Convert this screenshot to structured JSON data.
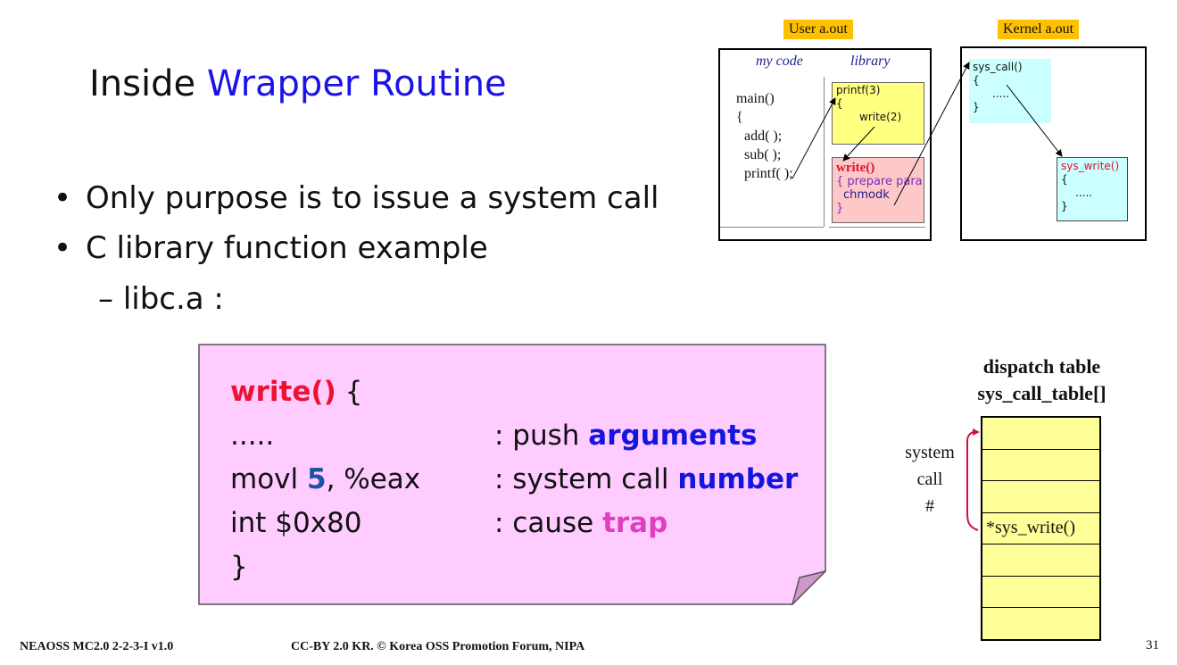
{
  "slide": {
    "title_plain": "Inside ",
    "title_accent": "Wrapper Routine",
    "bullets": [
      "Only purpose is to issue a system call",
      "C library function example"
    ],
    "sub_bullet": "libc.a :",
    "bullet_marker": "•",
    "sub_bullet_marker": "–",
    "page_number": "31"
  },
  "colors": {
    "title_accent": "#1a12e8",
    "tag_bg": "#ffc000",
    "note_bg": "#ffccff",
    "table_bg": "#ffff99"
  },
  "diagram": {
    "user_tag": "User   a.out",
    "kernel_tag": "Kernel   a.out",
    "my_code_label": "my code",
    "library_label": "library",
    "my_code_lines": [
      "main()",
      "{",
      "  add( );",
      "  sub( );",
      "  printf( );"
    ],
    "printf_box": [
      "printf(3)",
      "{",
      "write(2)"
    ],
    "write_box_title": "write()",
    "write_box_lines": [
      "{ prepare para",
      "chmodk",
      "}"
    ],
    "sys_call_box": [
      "sys_call()",
      "{",
      ".....",
      "}"
    ],
    "sys_write_box": [
      "sys_write()",
      "{",
      ".....",
      "}"
    ]
  },
  "code_note": {
    "line1_fn": "write()",
    "line1_rest": " {",
    "line2_left": ".....",
    "line2_comment": ": push ",
    "line2_emph": "arguments",
    "line3_left_a": "movl   ",
    "line3_num": "5",
    "line3_left_b": ", %eax",
    "line3_comment": ": system call ",
    "line3_emph": "number",
    "line4_left": "int   $0x80",
    "line4_comment": ": cause ",
    "line4_emph": "trap",
    "line5": "}"
  },
  "dispatch": {
    "title_line1": "dispatch table",
    "title_line2": "sys_call_table[]",
    "side_label": [
      "system",
      "call",
      "#"
    ],
    "rows": [
      "",
      "",
      "",
      "*sys_write()",
      "",
      "",
      ""
    ]
  },
  "footer": {
    "left": "NEAOSS MC2.0 2-2-3-I v1.0",
    "center": "CC-BY 2.0 KR. © Korea OSS Promotion Forum, NIPA"
  }
}
